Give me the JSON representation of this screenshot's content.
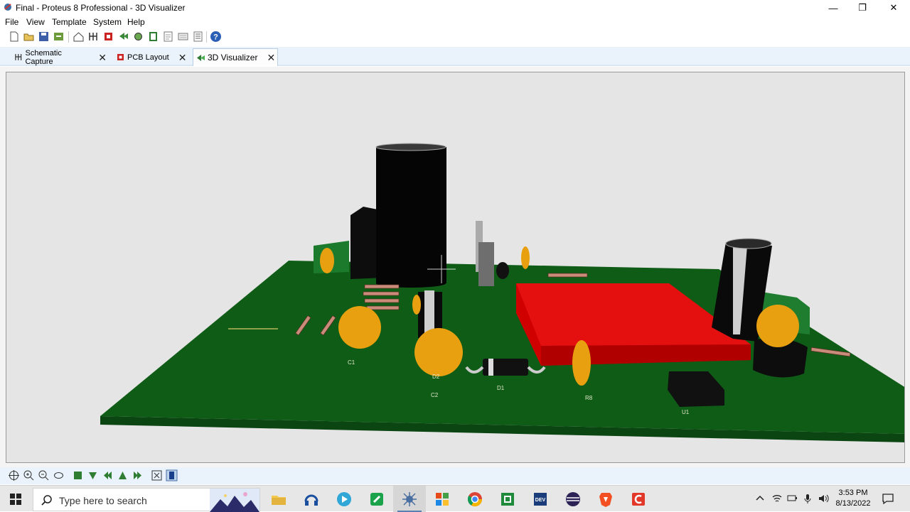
{
  "window": {
    "title": "Final - Proteus 8 Professional - 3D Visualizer",
    "minimize": "—",
    "maximize": "❐",
    "close": "✕"
  },
  "menu": [
    "File",
    "View",
    "Template",
    "System",
    "Help"
  ],
  "tabs": [
    {
      "label": "Schematic Capture",
      "close": "✕"
    },
    {
      "label": "PCB Layout",
      "close": "✕"
    },
    {
      "label": "3D Visualizer",
      "close": "✕"
    }
  ],
  "toolbar_icons": [
    "new-icon",
    "open-icon",
    "save-icon",
    "import-icon",
    "home-icon",
    "schematic-icon",
    "pcb-icon",
    "gerber-icon",
    "3d-icon",
    "bom-icon",
    "notes-icon",
    "report-icon",
    "help-icon"
  ],
  "nav_icons": [
    "pan-icon",
    "zoom-in-icon",
    "zoom-out-icon",
    "orbit-icon",
    "top-view-icon",
    "front-view-icon",
    "left-view-icon",
    "back-view-icon",
    "right-view-icon",
    "fit-icon",
    "flip-icon"
  ],
  "board": {
    "pcb_color": "#0f5c17",
    "component_labels": [
      "C1",
      "C2",
      "D1",
      "D2",
      "R8",
      "U1"
    ]
  },
  "taskbar": {
    "search_placeholder": "Type here to search",
    "time": "3:53 PM",
    "date": "8/13/2022",
    "apps": [
      "file-explorer-icon",
      "headphones-app-icon",
      "media-player-icon",
      "phone-link-icon",
      "proteus-icon",
      "office-icon",
      "chrome-icon",
      "code-blocks-icon",
      "dev-cpp-icon",
      "eclipse-icon",
      "brave-icon",
      "codeblocks-red-icon"
    ],
    "tray": [
      "chevron-up-icon",
      "wifi-icon",
      "network-icon",
      "battery-icon",
      "mic-icon",
      "volume-icon"
    ]
  }
}
